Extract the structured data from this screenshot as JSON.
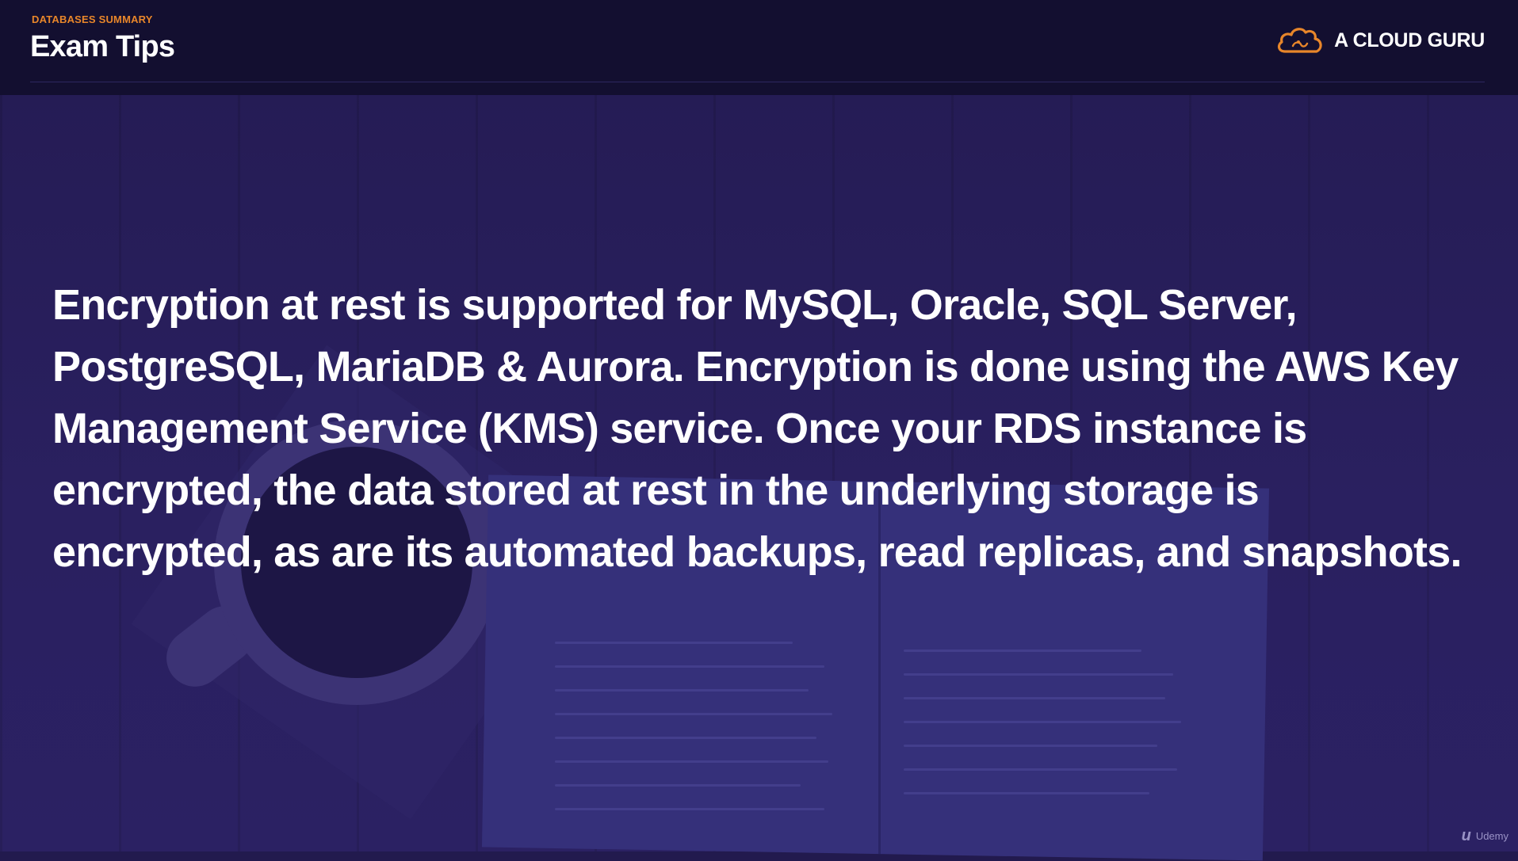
{
  "header": {
    "kicker": "DATABASES SUMMARY",
    "title": "Exam Tips",
    "brand_name": "A CLOUD GURU",
    "brand_icon": "cloud-guru-logo-icon",
    "accent_color": "#e8862a"
  },
  "content": {
    "paragraph": "Encryption at rest is supported for MySQL, Oracle, SQL Server, PostgreSQL, MariaDB & Aurora. Encryption is done using the AWS Key Management Service (KMS) service. Once your RDS instance is encrypted, the data stored at rest in the underlying storage is encrypted, as are its automated backups, read replicas, and snapshots."
  },
  "watermark": {
    "icon": "udemy-logo-icon",
    "label": "Udemy"
  },
  "colors": {
    "header_bg": "#130f30",
    "overlay": "#221a4e",
    "text": "#ffffff"
  }
}
